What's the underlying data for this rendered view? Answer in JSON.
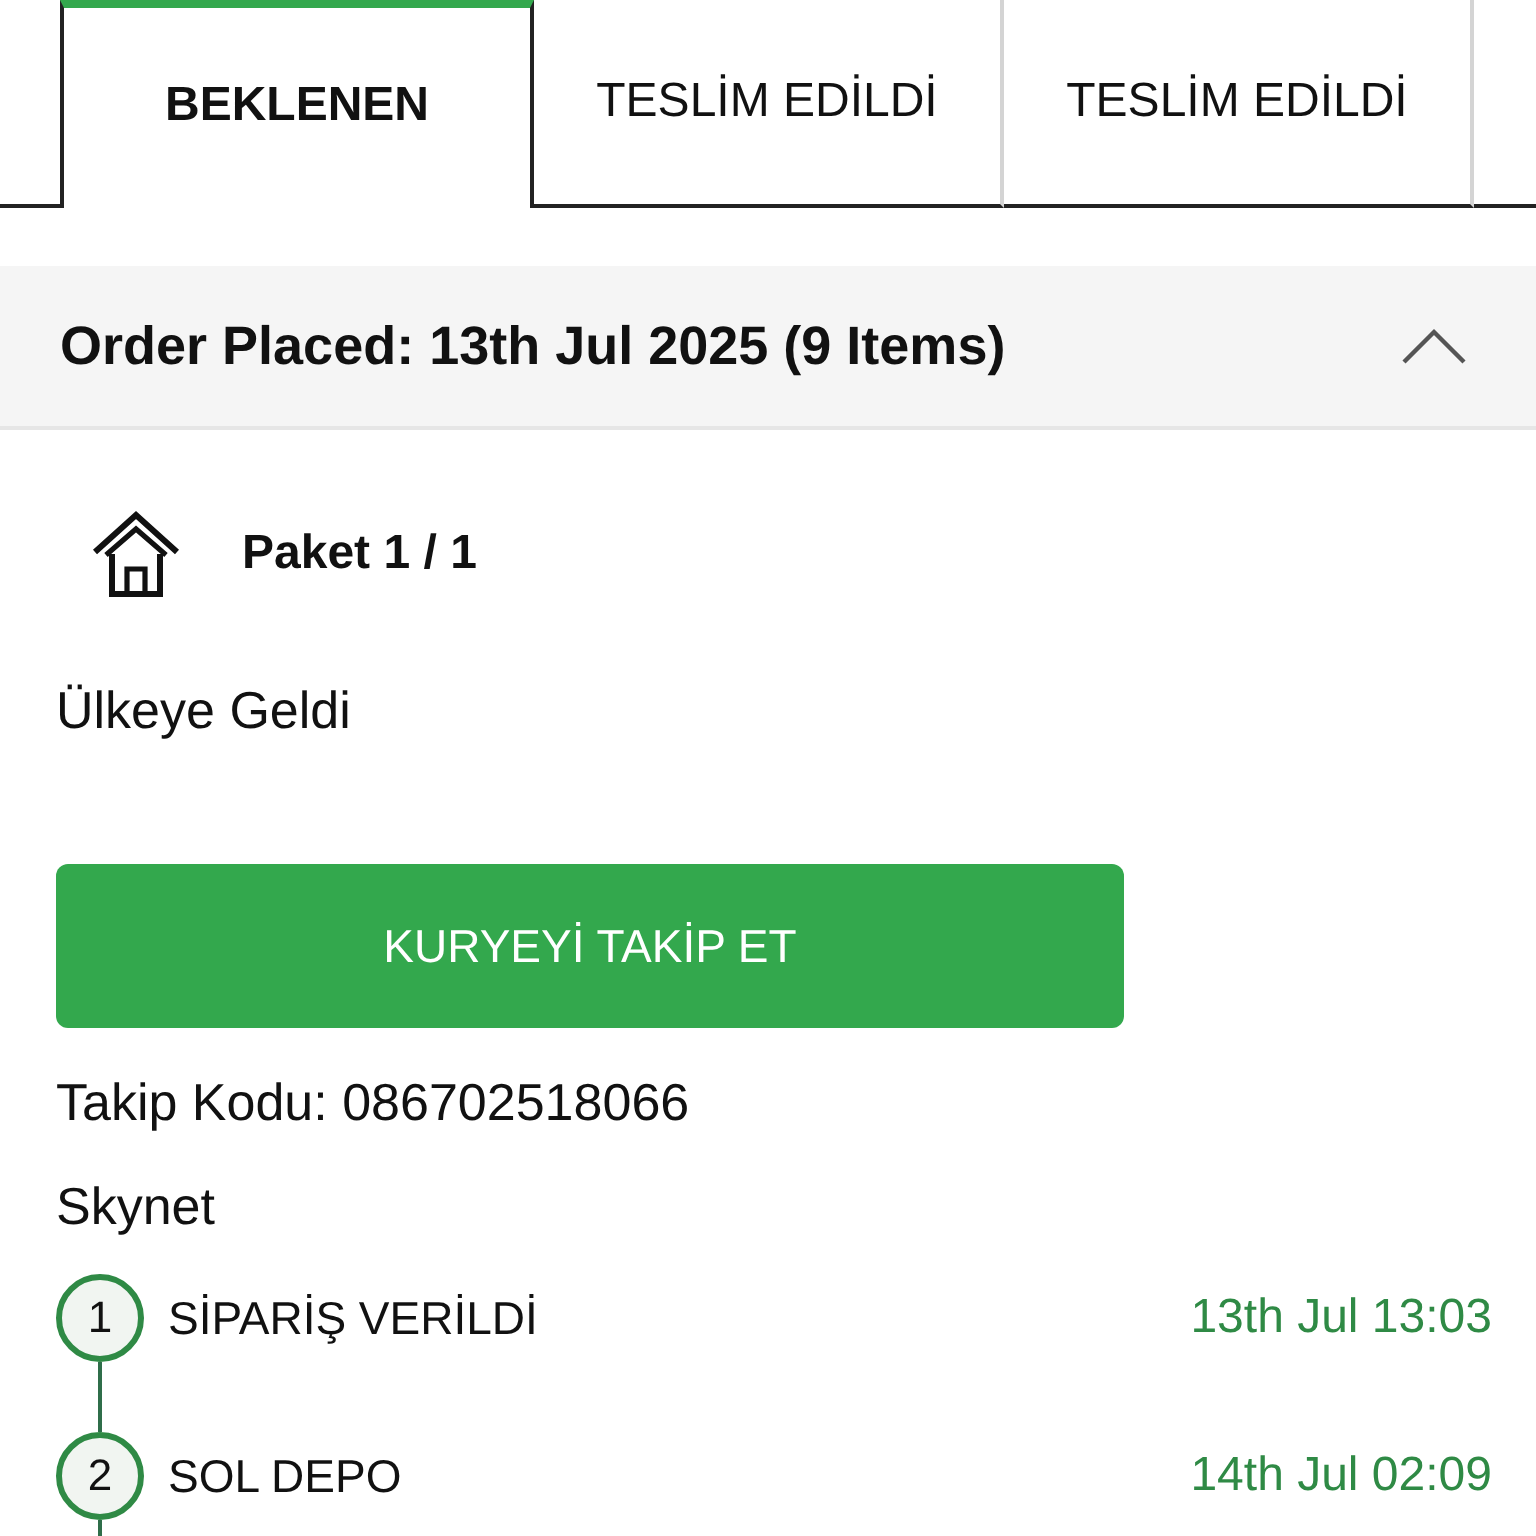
{
  "tabs": [
    {
      "label": "BEKLENEN",
      "selected": true
    },
    {
      "label": "TESLİM EDİLDİ",
      "selected": false
    },
    {
      "label": "TESLİM EDİLDİ",
      "selected": false
    }
  ],
  "order": {
    "title": "Order Placed: 13th Jul 2025 (9 Items)",
    "expanded": true
  },
  "package": {
    "title": "Paket 1 / 1",
    "status": "Ülkeye Geldi"
  },
  "track_button": "KURYEYİ TAKİP ET",
  "tracking_code": "Takip Kodu: 086702518066",
  "carrier": "Skynet",
  "timeline": [
    {
      "number": "1",
      "label": "SİPARİŞ VERİLDİ",
      "time": "13th Jul 13:03"
    },
    {
      "number": "2",
      "label": "SOL DEPO",
      "time": "14th Jul 02:09"
    }
  ]
}
